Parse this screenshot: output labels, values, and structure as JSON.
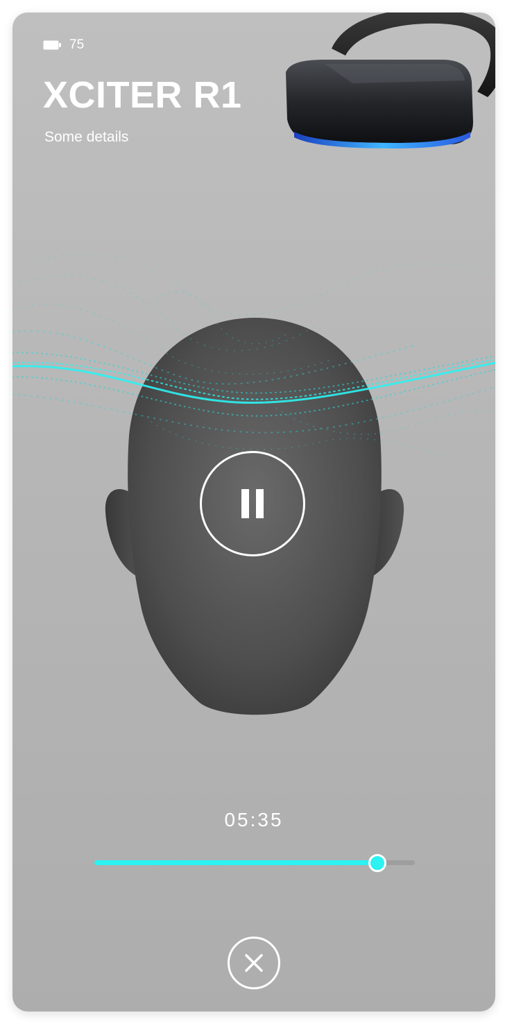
{
  "device": {
    "battery_level": "75",
    "name": "XCITER R1",
    "details": "Some details"
  },
  "player": {
    "state": "playing",
    "elapsed": "05:35",
    "progress_fraction": 0.88
  },
  "icons": {
    "battery": "battery-icon",
    "headset": "vr-headset-image",
    "pause": "pause-icon",
    "close": "close-icon"
  },
  "colors": {
    "accent": "#2cf2f2",
    "background": "#b8b8b8",
    "text": "#ffffff",
    "head": "#555555"
  }
}
